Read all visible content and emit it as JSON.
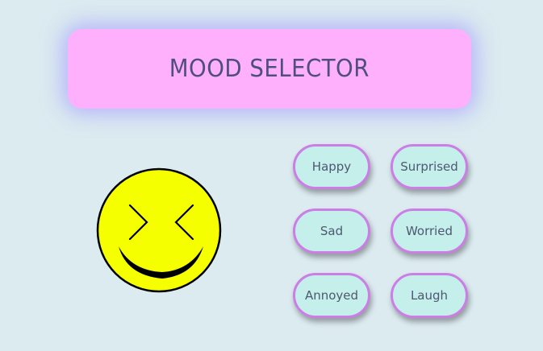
{
  "header": {
    "title": "MOOD SELECTOR"
  },
  "face": {
    "expression": "laugh",
    "fill_color": "#f5ff00",
    "outline_color": "#000000"
  },
  "mood_buttons": [
    {
      "label": "Happy"
    },
    {
      "label": "Surprised"
    },
    {
      "label": "Sad"
    },
    {
      "label": "Worried"
    },
    {
      "label": "Annoyed"
    },
    {
      "label": "Laugh"
    }
  ],
  "colors": {
    "background": "#dbebf0",
    "header_background": "#feb0fc",
    "header_glow": "#a096ff",
    "title_text": "#4f4f7d",
    "button_fill": "#c5efea",
    "button_border": "#cc7de6",
    "button_text": "#4e5870"
  }
}
